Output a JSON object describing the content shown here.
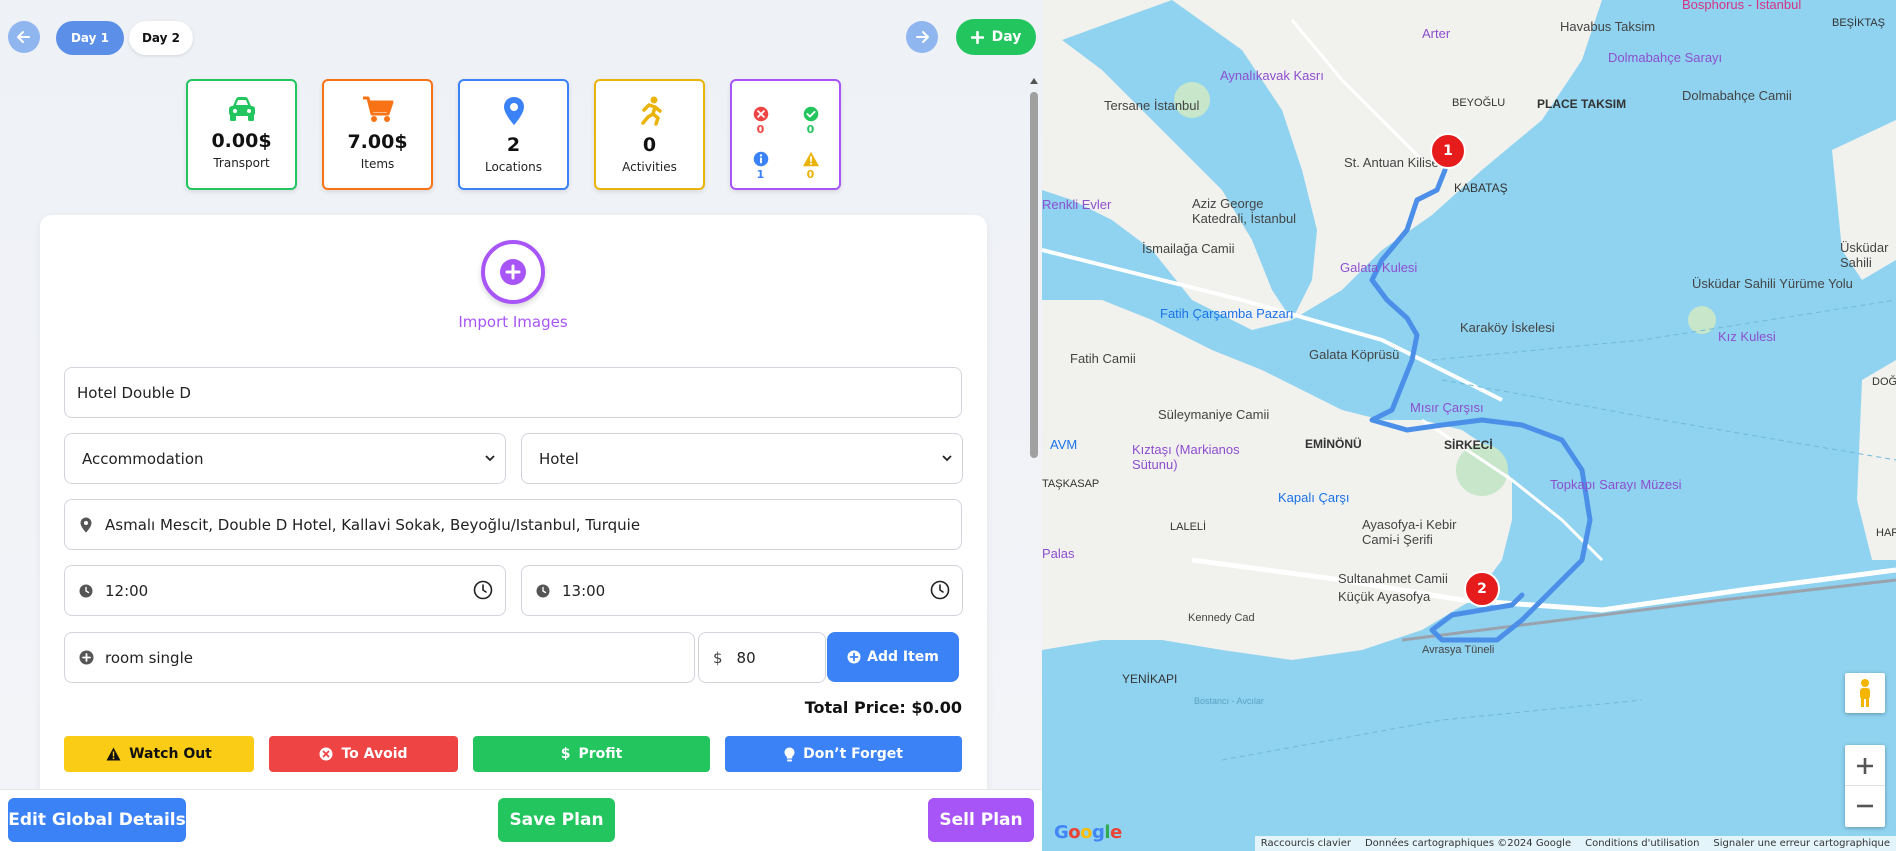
{
  "days": {
    "tabs": [
      {
        "label": "Day 1",
        "active": true
      },
      {
        "label": "Day 2",
        "active": false
      }
    ],
    "add_label": "Day"
  },
  "stats": {
    "transport": {
      "value": "0.00$",
      "label": "Transport",
      "color": "#22c55e",
      "icon": "car-icon"
    },
    "items": {
      "value": "7.00$",
      "label": "Items",
      "color": "#f97316",
      "icon": "cart-icon"
    },
    "locations": {
      "value": "2",
      "label": "Locations",
      "color": "#3b82f6",
      "icon": "map-pin-icon"
    },
    "activities": {
      "value": "0",
      "label": "Activities",
      "color": "#eab308",
      "icon": "running-icon"
    },
    "alerts": {
      "avoid_count": "0",
      "profit_count": "0",
      "info_count": "1",
      "watch_count": "0",
      "border_color": "#a855f7"
    }
  },
  "form": {
    "import_label": "Import Images",
    "name_value": "Hotel Double D",
    "category_value": "Accommodation",
    "type_value": "Hotel",
    "address_value": "Asmalı Mescit, Double D Hotel, Kallavi Sokak, Beyoğlu/Istanbul, Turquie",
    "start_time": "12:00",
    "end_time": "13:00",
    "item_name": "room single",
    "currency_symbol": "$",
    "item_price": "80",
    "add_item_label": "Add Item",
    "total_price": "Total Price: $0.00"
  },
  "tags": {
    "watch_out": "Watch Out",
    "to_avoid": "To Avoid",
    "profit": "Profit",
    "dont_forget": "Don’t Forget"
  },
  "footer": {
    "edit_label": "Edit Global Details",
    "save_label": "Save Plan",
    "sell_label": "Sell Plan"
  },
  "map": {
    "labels": [
      "Bosphorus - İstanbul",
      "BEŞİKTAŞ",
      "Havabus Taksim",
      "Arter",
      "Dolmabahçe Sarayı",
      "Aynalıkavak Kasrı",
      "Tersane İstanbul",
      "BEYOĞLU",
      "PLACE TAKSIM",
      "Dolmabahçe Camii",
      "St. Antuan Kilisesi",
      "KABATAŞ",
      "Renkli Evler",
      "Aziz George Katedrali, İstanbul",
      "İsmailağa Camii",
      "Galata Kulesi",
      "Üsküdar Sahili",
      "Üsküdar Sahili Yürüme Yolu",
      "Fatih Çarşamba Pazarı",
      "Karaköy İskelesi",
      "Kız Kulesi",
      "Fatih Camii",
      "Galata Köprüsü",
      "Mısır Çarşısı",
      "DOĞAN",
      "Süleymaniye Camii",
      "AVM",
      "Kıztaşı (Markianos Sütunu)",
      "EMİNÖNÜ",
      "SİRKECİ",
      "TAŞKASAP",
      "Kapalı Çarşı",
      "Topkapı Sarayı Müzesi",
      "LALELİ",
      "Ayasofya-i Kebir Cami-i Şerifi",
      "HARE",
      "Palas",
      "Sultanahmet Camii",
      "Küçük Ayasofya",
      "YENİKAPI",
      "Avrasya Tüneli",
      "Kennedy Cad",
      "Bostancı - Avcılar"
    ],
    "markers": [
      "1",
      "2"
    ],
    "attribution": [
      "Raccourcis clavier",
      "Données cartographiques ©2024 Google",
      "Conditions d'utilisation",
      "Signaler une erreur cartographique"
    ],
    "logo": "Google"
  }
}
